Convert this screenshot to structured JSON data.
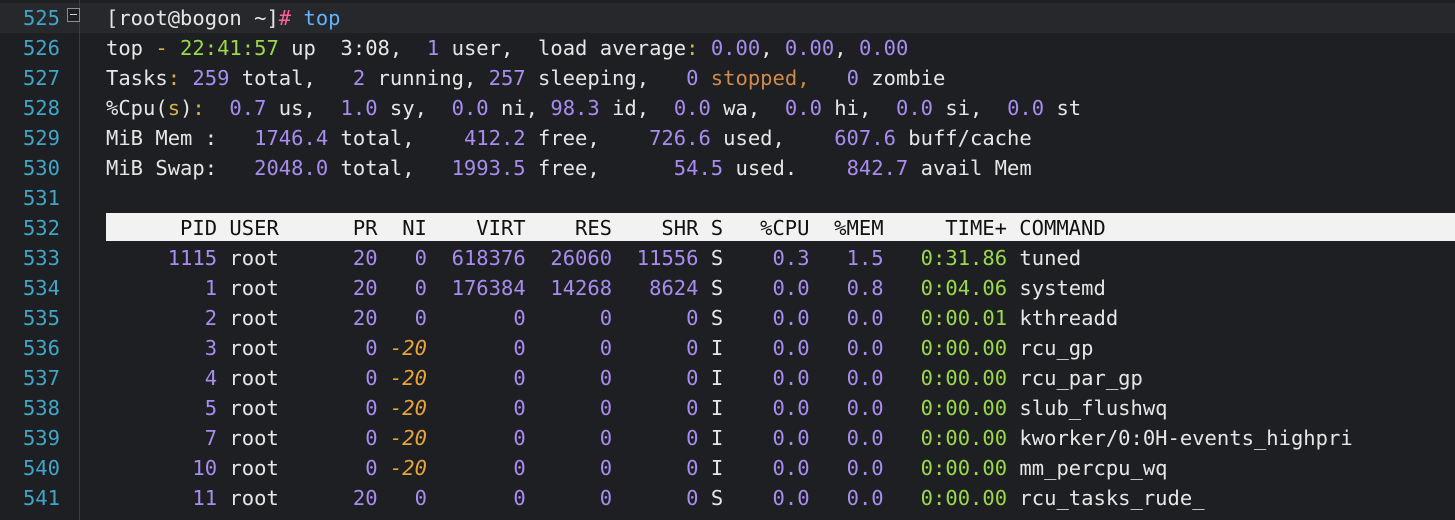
{
  "prompt": {
    "user_host": "[root@bogon ~]",
    "hash": "#",
    "command": "top"
  },
  "summary": {
    "uptime_label": "top",
    "dash": "-",
    "time": "22:41:57",
    "up_label": "up",
    "uptime": "3:08,",
    "users": "1",
    "users_label": "user,",
    "load_label": "load average",
    "colon": ":",
    "load1": "0.00",
    "load5": "0.00",
    "load15": "0.00",
    "tasks_label": "Tasks",
    "tasks_total": "259",
    "total_label": "total,",
    "running": "2",
    "running_label": "running,",
    "sleeping": "257",
    "sleeping_label": "sleeping,",
    "stopped": "0",
    "stopped_label": "stopped,",
    "zombie": "0",
    "zombie_label": "zombie",
    "cpu_label": "%Cpu",
    "cpu_s": "s",
    "cpu_us": "0.7",
    "cpu_sy": "1.0",
    "cpu_ni": "0.0",
    "cpu_id": "98.3",
    "cpu_wa": "0.0",
    "cpu_hi": "0.0",
    "cpu_si": "0.0",
    "cpu_st": "0.0",
    "mem_label": "MiB Mem :",
    "mem_total": "1746.4",
    "mem_free": "412.2",
    "mem_used": "726.6",
    "mem_buff": "607.6",
    "swap_label": "MiB Swap:",
    "swap_total": "2048.0",
    "swap_free": "1993.5",
    "swap_used": "54.5",
    "swap_avail": "842.7"
  },
  "line_numbers": [
    "525",
    "526",
    "527",
    "528",
    "529",
    "530",
    "531",
    "532",
    "533",
    "534",
    "535",
    "536",
    "537",
    "538",
    "539",
    "540",
    "541"
  ],
  "columns": [
    "PID",
    "USER",
    "PR",
    "NI",
    "VIRT",
    "RES",
    "SHR",
    "S",
    "%CPU",
    "%MEM",
    "TIME+",
    "COMMAND"
  ],
  "processes": [
    {
      "pid": "1115",
      "user": "root",
      "pr": "20",
      "ni": "0",
      "virt": "618376",
      "res": "26060",
      "shr": "11556",
      "s": "S",
      "cpu": "0.3",
      "mem": "1.5",
      "time": "0:31.86",
      "cmd": "tuned"
    },
    {
      "pid": "1",
      "user": "root",
      "pr": "20",
      "ni": "0",
      "virt": "176384",
      "res": "14268",
      "shr": "8624",
      "s": "S",
      "cpu": "0.0",
      "mem": "0.8",
      "time": "0:04.06",
      "cmd": "systemd"
    },
    {
      "pid": "2",
      "user": "root",
      "pr": "20",
      "ni": "0",
      "virt": "0",
      "res": "0",
      "shr": "0",
      "s": "S",
      "cpu": "0.0",
      "mem": "0.0",
      "time": "0:00.01",
      "cmd": "kthreadd"
    },
    {
      "pid": "3",
      "user": "root",
      "pr": "0",
      "ni": "-20",
      "virt": "0",
      "res": "0",
      "shr": "0",
      "s": "I",
      "cpu": "0.0",
      "mem": "0.0",
      "time": "0:00.00",
      "cmd": "rcu_gp"
    },
    {
      "pid": "4",
      "user": "root",
      "pr": "0",
      "ni": "-20",
      "virt": "0",
      "res": "0",
      "shr": "0",
      "s": "I",
      "cpu": "0.0",
      "mem": "0.0",
      "time": "0:00.00",
      "cmd": "rcu_par_gp"
    },
    {
      "pid": "5",
      "user": "root",
      "pr": "0",
      "ni": "-20",
      "virt": "0",
      "res": "0",
      "shr": "0",
      "s": "I",
      "cpu": "0.0",
      "mem": "0.0",
      "time": "0:00.00",
      "cmd": "slub_flushwq"
    },
    {
      "pid": "7",
      "user": "root",
      "pr": "0",
      "ni": "-20",
      "virt": "0",
      "res": "0",
      "shr": "0",
      "s": "I",
      "cpu": "0.0",
      "mem": "0.0",
      "time": "0:00.00",
      "cmd": "kworker/0:0H-events_highpri"
    },
    {
      "pid": "10",
      "user": "root",
      "pr": "0",
      "ni": "-20",
      "virt": "0",
      "res": "0",
      "shr": "0",
      "s": "I",
      "cpu": "0.0",
      "mem": "0.0",
      "time": "0:00.00",
      "cmd": "mm_percpu_wq"
    },
    {
      "pid": "11",
      "user": "root",
      "pr": "20",
      "ni": "0",
      "virt": "0",
      "res": "0",
      "shr": "0",
      "s": "S",
      "cpu": "0.0",
      "mem": "0.0",
      "time": "0:00.00",
      "cmd": "rcu_tasks_rude_"
    }
  ]
}
